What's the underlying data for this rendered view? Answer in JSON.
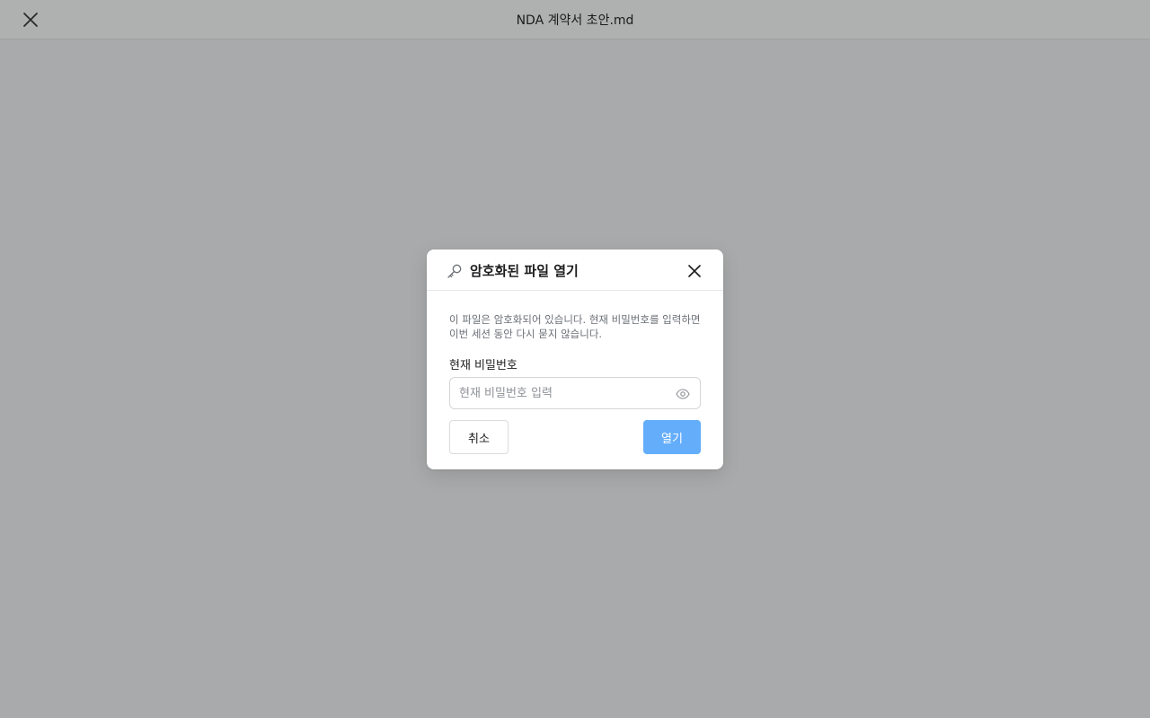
{
  "window": {
    "title": "NDA 계약서 초안.md",
    "close_icon": "close-icon"
  },
  "dialog": {
    "header_icon": "key-icon",
    "title": "암호화된 파일 열기",
    "close_icon": "close-icon",
    "description": "이 파일은 암호화되어 있습니다. 현재 비밀번호를 입력하면 이번 세션 동안 다시 묻지 않습니다.",
    "field_label": "현재 비밀번호",
    "password_value": "",
    "password_placeholder": "현재 비밀번호 입력",
    "toggle_icon": "eye-icon",
    "cancel_label": "취소",
    "open_label": "열기",
    "open_button_color": "#64adfb"
  }
}
